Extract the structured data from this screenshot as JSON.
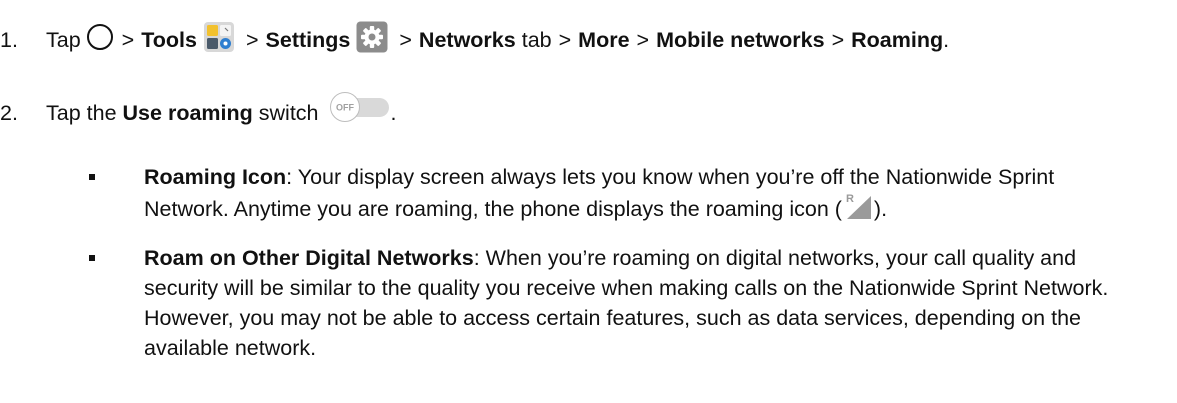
{
  "steps": [
    {
      "number": "1.",
      "parts": {
        "tap": "Tap",
        "sep": ">",
        "tools": "Tools",
        "settings": "Settings",
        "networks": "Networks",
        "tab_word": "tab",
        "more": "More",
        "mobile_networks": "Mobile networks",
        "roaming": "Roaming",
        "end": "."
      },
      "icons": [
        "home-circle-icon",
        "tools-folder-icon",
        "settings-gear-icon"
      ]
    },
    {
      "number": "2.",
      "parts": {
        "tap_the": "Tap the",
        "use_roaming": "Use roaming",
        "switch_word": "switch",
        "switch_label": "OFF",
        "end": "."
      },
      "icons": [
        "toggle-switch-off-icon"
      ]
    }
  ],
  "bullets": [
    {
      "title": "Roaming Icon",
      "colon": ":",
      "text_before_icon": " Your display screen always lets you know when you’re off the Nationwide Sprint Network. Anytime you are roaming, the phone displays the roaming icon (",
      "icon_letter": "R",
      "icon": "roaming-signal-icon",
      "text_after_icon": ")."
    },
    {
      "title": "Roam on Other Digital Networks",
      "colon": ":",
      "text": " When you’re roaming on digital networks, your call quality and security will be similar to the quality you receive when making calls on the Nationwide Sprint Network. However, you may not be able to access certain features, such as data services, depending on the available network."
    }
  ],
  "colors": {
    "text": "#111111",
    "icon_gray": "#9a9a9a",
    "switch_track": "#d9d9d9",
    "tools_blue": "#2f7fd0",
    "tools_yellow": "#f2c12e"
  }
}
